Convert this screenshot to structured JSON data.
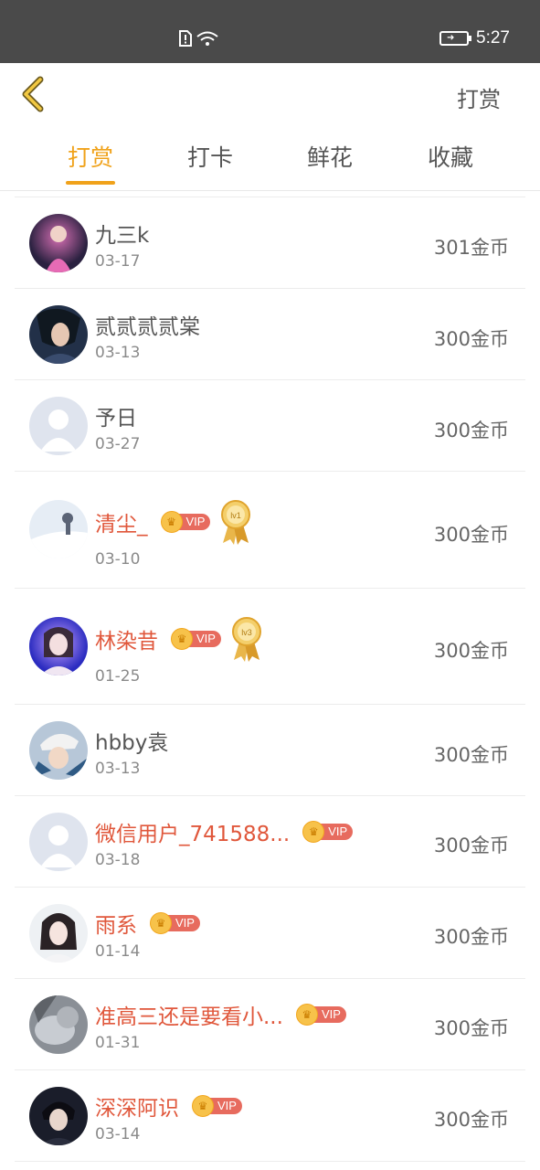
{
  "status_bar": {
    "time": "5:27",
    "icons": [
      "sim-alert-icon",
      "wifi-icon",
      "battery-charging-icon"
    ]
  },
  "header": {
    "back_icon": "chevron-left-icon",
    "title": "打赏"
  },
  "tabs": [
    {
      "label": "打赏",
      "active": true
    },
    {
      "label": "打卡",
      "active": false
    },
    {
      "label": "鲜花",
      "active": false
    },
    {
      "label": "收藏",
      "active": false
    }
  ],
  "colors": {
    "accent": "#f0a21a",
    "vip_name": "#e0573b",
    "vip_tag": "#e76b5e"
  },
  "vip_label": "VIP",
  "rewards": [
    {
      "name": "九三k",
      "date": "03-17",
      "amount": "301金币",
      "vip": false
    },
    {
      "name": "贰贰贰贰棠",
      "date": "03-13",
      "amount": "300金币",
      "vip": false
    },
    {
      "name": "予日",
      "date": "03-27",
      "amount": "300金币",
      "vip": false
    },
    {
      "name": "清尘_",
      "date": "03-10",
      "amount": "300金币",
      "vip": true,
      "level": "lv1"
    },
    {
      "name": "林染昔",
      "date": "01-25",
      "amount": "300金币",
      "vip": true,
      "level": "lv3"
    },
    {
      "name": "hbby袁",
      "date": "03-13",
      "amount": "300金币",
      "vip": false
    },
    {
      "name": "微信用户_741588...",
      "date": "03-18",
      "amount": "300金币",
      "vip": true
    },
    {
      "name": "雨系",
      "date": "01-14",
      "amount": "300金币",
      "vip": true
    },
    {
      "name": "准高三还是要看小...",
      "date": "01-31",
      "amount": "300金币",
      "vip": true
    },
    {
      "name": "深深阿识",
      "date": "03-14",
      "amount": "300金币",
      "vip": true
    }
  ]
}
